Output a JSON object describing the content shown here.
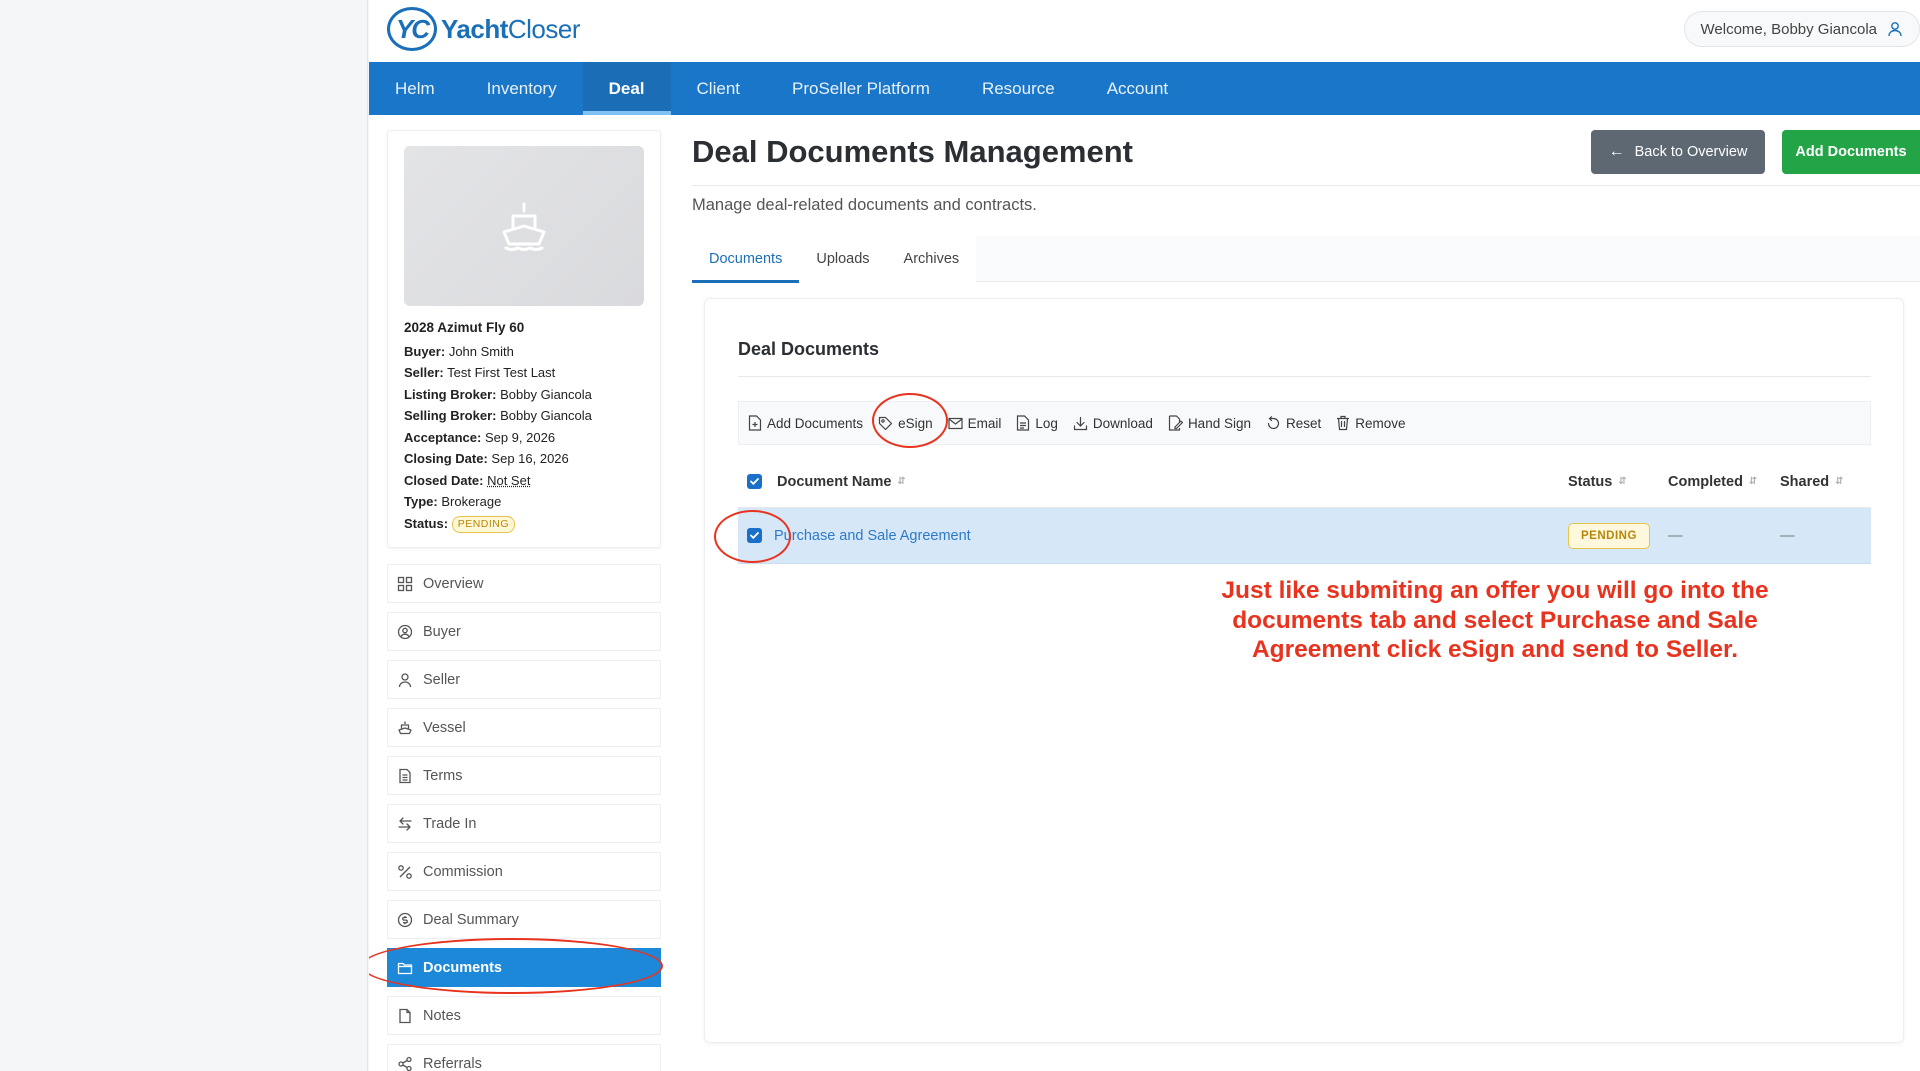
{
  "header": {
    "logo_mark": "YC",
    "logo_text_bold": "Yacht",
    "logo_text_light": "Closer",
    "welcome": "Welcome, Bobby Giancola"
  },
  "nav": [
    {
      "label": "Helm",
      "active": false
    },
    {
      "label": "Inventory",
      "active": false
    },
    {
      "label": "Deal",
      "active": true
    },
    {
      "label": "Client",
      "active": false
    },
    {
      "label": "ProSeller Platform",
      "active": false
    },
    {
      "label": "Resource",
      "active": false
    },
    {
      "label": "Account",
      "active": false
    }
  ],
  "deal": {
    "title": "2028 Azimut Fly 60",
    "rows": [
      {
        "label": "Buyer:",
        "value": "John Smith"
      },
      {
        "label": "Seller:",
        "value": "Test First Test Last"
      },
      {
        "label": "Listing Broker:",
        "value": "Bobby Giancola"
      },
      {
        "label": "Selling Broker:",
        "value": "Bobby Giancola"
      },
      {
        "label": "Acceptance:",
        "value": "Sep 9, 2026"
      },
      {
        "label": "Closing Date:",
        "value": "Sep 16, 2026"
      },
      {
        "label": "Closed Date:",
        "value": "Not Set"
      },
      {
        "label": "Type:",
        "value": "Brokerage"
      },
      {
        "label": "Status:",
        "value": "PENDING"
      }
    ]
  },
  "side_menu": [
    {
      "label": "Overview",
      "icon": "grid-icon",
      "active": false
    },
    {
      "label": "Buyer",
      "icon": "user-circle-icon",
      "active": false
    },
    {
      "label": "Seller",
      "icon": "user-icon",
      "active": false
    },
    {
      "label": "Vessel",
      "icon": "ship-icon",
      "active": false
    },
    {
      "label": "Terms",
      "icon": "document-icon",
      "active": false
    },
    {
      "label": "Trade In",
      "icon": "swap-icon",
      "active": false
    },
    {
      "label": "Commission",
      "icon": "percent-icon",
      "active": false
    },
    {
      "label": "Deal Summary",
      "icon": "dollar-circle-icon",
      "active": false
    },
    {
      "label": "Documents",
      "icon": "folder-icon",
      "active": true
    },
    {
      "label": "Notes",
      "icon": "note-icon",
      "active": false
    },
    {
      "label": "Referrals",
      "icon": "share-icon",
      "active": false
    }
  ],
  "main": {
    "title": "Deal Documents Management",
    "subtitle": "Manage deal-related documents and contracts.",
    "back_button": "Back to Overview",
    "add_button": "Add Documents",
    "tabs": [
      {
        "label": "Documents",
        "active": true
      },
      {
        "label": "Uploads",
        "active": false
      },
      {
        "label": "Archives",
        "active": false
      }
    ]
  },
  "panel": {
    "title": "Deal Documents",
    "toolbar": [
      {
        "label": "Add Documents",
        "icon": "file-plus-icon"
      },
      {
        "label": "eSign",
        "icon": "pen-tag-icon"
      },
      {
        "label": "Email",
        "icon": "envelope-icon"
      },
      {
        "label": "Log",
        "icon": "log-icon"
      },
      {
        "label": "Download",
        "icon": "download-icon"
      },
      {
        "label": "Hand Sign",
        "icon": "hand-sign-icon"
      },
      {
        "label": "Reset",
        "icon": "reset-icon"
      },
      {
        "label": "Remove",
        "icon": "trash-icon"
      }
    ],
    "columns": {
      "name": "Document Name",
      "status": "Status",
      "completed": "Completed",
      "shared": "Shared"
    },
    "rows": [
      {
        "name": "Purchase and Sale Agreement",
        "status": "PENDING",
        "completed": "—",
        "shared": "—",
        "checked": true
      }
    ]
  },
  "annotation": {
    "text": "Just like submiting an offer you will go into the documents tab and select Purchase and Sale Agreement click eSign and send to Seller.",
    "color": "#e8331f"
  },
  "colors": {
    "nav_bg": "#1976c8",
    "active_menu": "#1e88d8",
    "add_button": "#22a447",
    "back_button": "#5d6872",
    "pending": "#b8860b"
  }
}
